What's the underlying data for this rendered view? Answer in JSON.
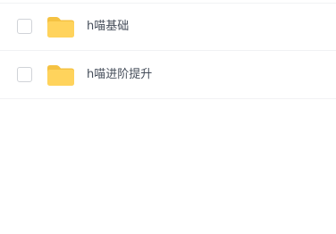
{
  "file_list": {
    "items": [
      {
        "icon": "folder-icon",
        "name": "h喵基础",
        "checked": false
      },
      {
        "icon": "folder-icon",
        "name": "h喵进阶提升",
        "checked": false
      }
    ]
  },
  "colors": {
    "folder": "#ffd35c",
    "folder_tab": "#f5c242",
    "text": "#454d5a",
    "checkbox_border": "#d0d3d8",
    "divider": "#f1f2f4"
  }
}
